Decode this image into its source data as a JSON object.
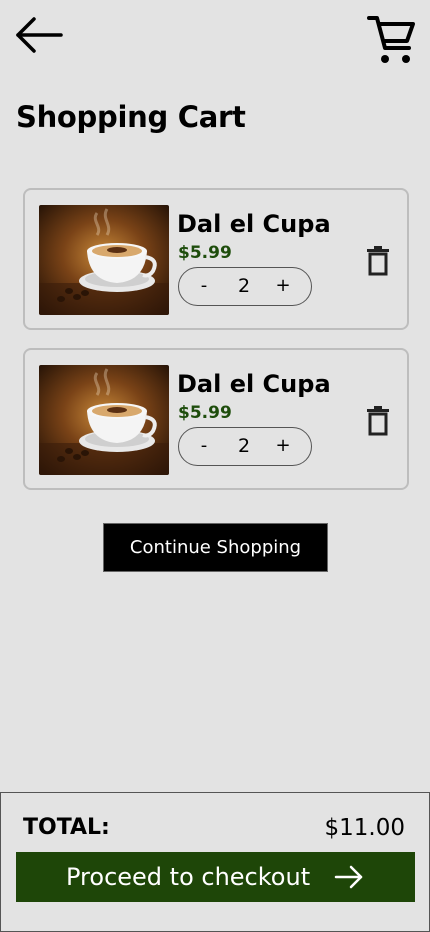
{
  "header": {
    "back_icon": "arrow-left-icon",
    "cart_icon": "shopping-cart-icon",
    "title": "Shopping Cart"
  },
  "cart": {
    "items": [
      {
        "name": "Dal el Cupa",
        "price": "$5.99",
        "quantity": "2",
        "minus_label": "-",
        "plus_label": "+",
        "image": "coffee-cup-image",
        "delete_icon": "trash-icon"
      },
      {
        "name": "Dal el Cupa",
        "price": "$5.99",
        "quantity": "2",
        "minus_label": "-",
        "plus_label": "+",
        "image": "coffee-cup-image",
        "delete_icon": "trash-icon"
      }
    ],
    "continue_label": "Continue Shopping"
  },
  "footer": {
    "total_label": "TOTAL:",
    "total_value": "$11.00",
    "checkout_label": "Proceed to checkout",
    "checkout_icon": "arrow-right-icon"
  },
  "colors": {
    "background": "#e3e3e3",
    "price_green": "#1e4d0c",
    "checkout_green": "#1e4608",
    "continue_button": "#000000"
  }
}
